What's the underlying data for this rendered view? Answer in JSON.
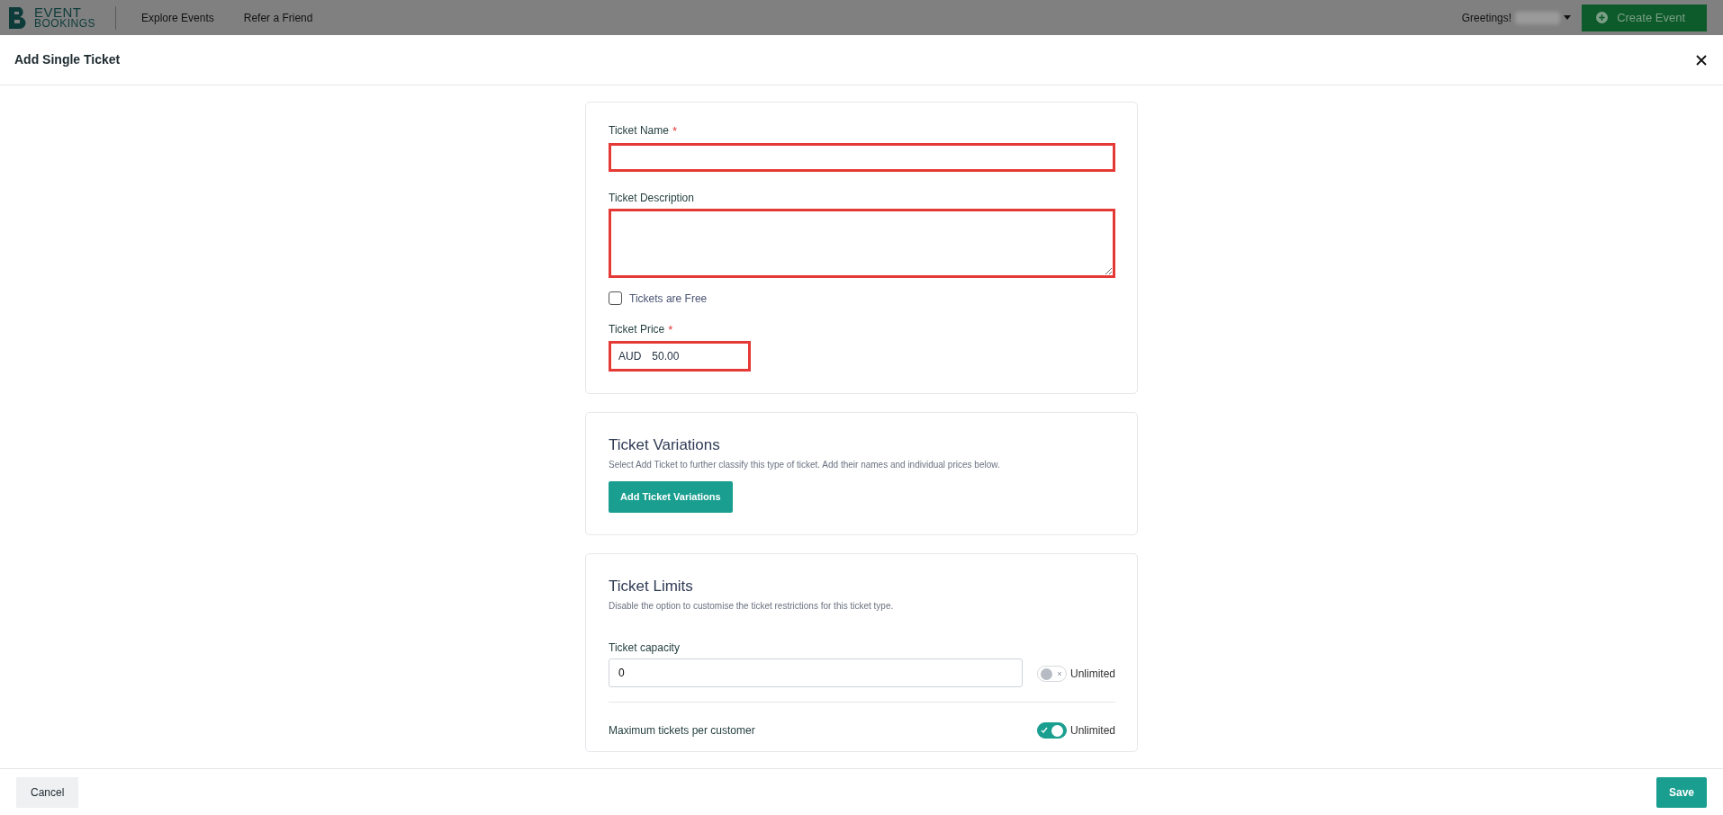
{
  "navbar": {
    "brand_top": "EVENT",
    "brand_bottom": "BOOKINGS",
    "links": [
      "Explore Events",
      "Refer a Friend"
    ],
    "greeting": "Greetings!",
    "create_button": "Create Event"
  },
  "modal": {
    "title": "Add Single Ticket",
    "details": {
      "name": {
        "label": "Ticket Name",
        "required_mark": "*",
        "invalid": true
      },
      "description": {
        "label": "Ticket Description",
        "invalid": true
      },
      "free": {
        "label": "Tickets are Free",
        "checked": false
      },
      "price": {
        "label": "Ticket Price",
        "required_mark": "*",
        "invalid": true,
        "currency": "AUD",
        "value": "50.00"
      }
    },
    "variations": {
      "heading": "Ticket Variations",
      "text": "Select Add Ticket to further classify this type of ticket. Add their names and individual prices below.",
      "button": "Add Ticket Variations"
    },
    "limits": {
      "heading": "Ticket Limits",
      "text": "Disable the option to customise the ticket restrictions for this ticket type.",
      "rows": [
        {
          "label": "Ticket capacity",
          "value": "0",
          "toggle_label": "Unlimited",
          "on": false
        },
        {
          "label": "Maximum tickets per customer",
          "toggle_label": "Unlimited",
          "on": true
        }
      ]
    },
    "cancel": "Cancel",
    "save": "Save"
  }
}
